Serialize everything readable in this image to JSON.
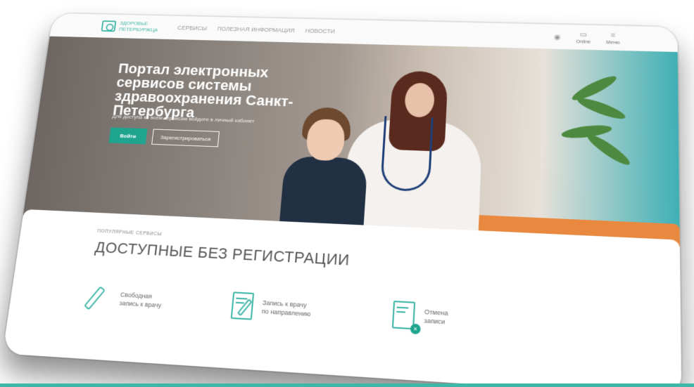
{
  "header": {
    "logo_line1": "ЗДОРОВЬЕ",
    "logo_line2": "ПЕТЕРБУРЖЦА",
    "nav": [
      "СЕРВИСЫ",
      "ПОЛЕЗНАЯ ИНФОРМАЦИЯ",
      "НОВОСТИ"
    ],
    "online_label": "Online",
    "menu_label": "Меню"
  },
  "hero": {
    "title": "Портал электронных сервисов системы здравоохранения Санкт-Петербурга",
    "subtitle": "Для доступа ко всем сервисам войдите в личный кабинет",
    "login_button": "Войти",
    "register_button": "Зарегистрироваться"
  },
  "content": {
    "section_caption": "ПОПУЛЯРНЫЕ СЕРВИСЫ",
    "section_title": "ДОСТУПНЫЕ БЕЗ РЕГИСТРАЦИИ",
    "services": [
      {
        "label_1": "Свободная",
        "label_2": "запись к врачу",
        "icon": "pen-icon"
      },
      {
        "label_1": "Запись к врачу",
        "label_2": "по направлению",
        "icon": "document-pen-icon"
      },
      {
        "label_1": "Отмена",
        "label_2": "записи",
        "icon": "document-cancel-icon"
      }
    ]
  },
  "colors": {
    "accent": "#3fb7a7",
    "button": "#1fa58f",
    "bottom_line": "#3fb7a7"
  }
}
